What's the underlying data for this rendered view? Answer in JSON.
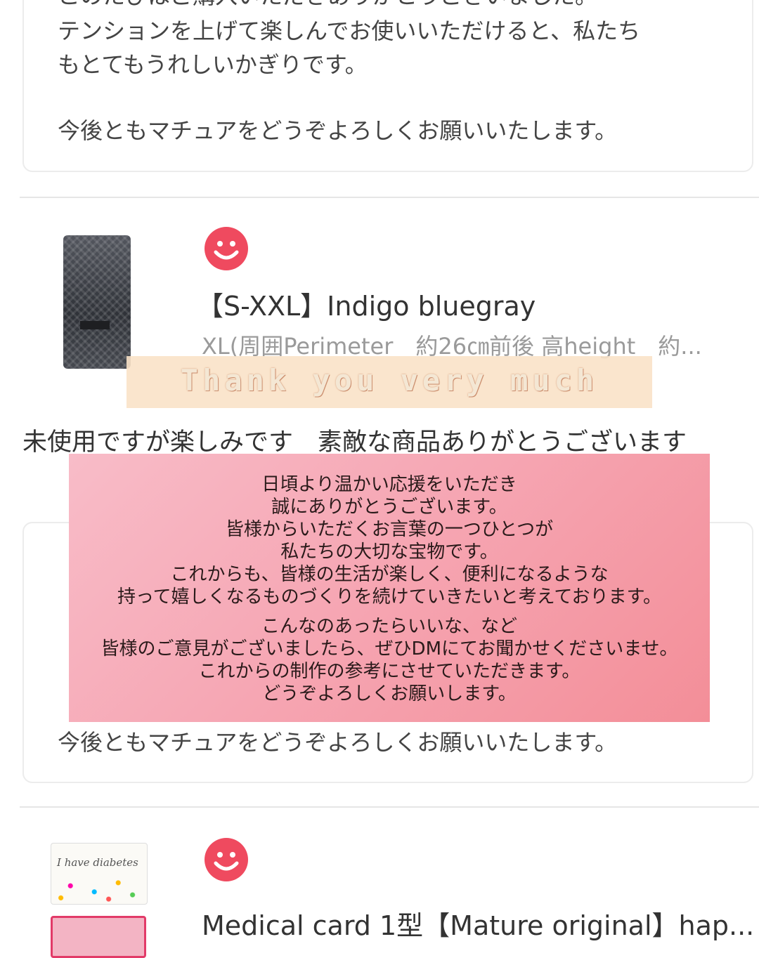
{
  "reply_top": {
    "lines_clipped": "このたびはご購入いただきありがとうございました。",
    "line2": "テンションを上げて楽しんでお使いいただけると、私たち",
    "line3": "もとてもうれしいかぎりです。",
    "closing": "今後ともマチュアをどうぞよろしくお願いいたします。"
  },
  "review1": {
    "product_title": "【S-XXL】Indigo bluegray",
    "variant": "XL(周囲Perimeter　約26㎝前後 高height　約...",
    "rating_icon": "smiley-icon",
    "comment": "未使用ですが楽しみです　素敵な商品ありがとうございます"
  },
  "reply_mid": {
    "closing": "今後ともマチュアをどうぞよろしくお願いいたします。"
  },
  "review2": {
    "product_title": "Medical card 1型【Mature original】hap...",
    "rating_icon": "smiley-icon",
    "card_text": "I have diabetes"
  },
  "banner": {
    "text": "Thank you very much"
  },
  "overlay": {
    "para1": [
      "日頃より温かい応援をいただき",
      "誠にありがとうございます。",
      "皆様からいただくお言葉の一つひとつが",
      "私たちの大切な宝物です。",
      "これからも、皆様の生活が楽しく、便利になるような",
      "持って嬉しくなるものづくりを続けていきたいと考えております。"
    ],
    "para2": [
      "こんなのあったらいいな、など",
      "皆様のご意見がございましたら、ぜひDMにてお聞かせくださいませ。",
      "これからの制作の参考にさせていただきます。",
      "どうぞよろしくお願いします。"
    ]
  },
  "colors": {
    "smiley": "#ef4a5f",
    "overlay_start": "#f8bcc8",
    "overlay_end": "#f38e98",
    "banner_bg": "#fae2c8"
  }
}
